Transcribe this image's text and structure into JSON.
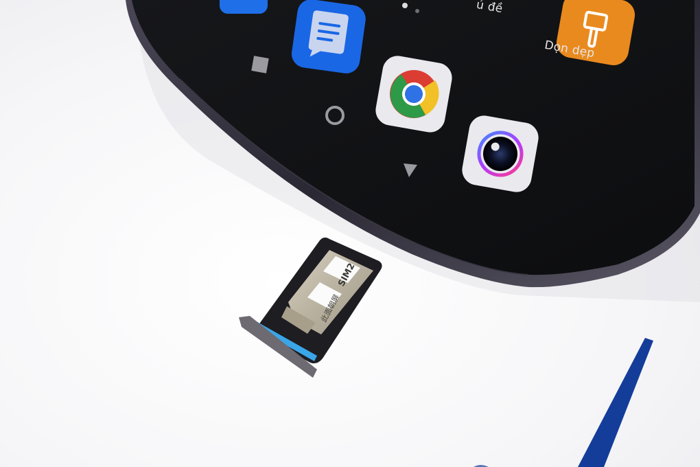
{
  "scene": {
    "description_label": "Phone home screen corner with ejected SIM tray",
    "colors": {
      "background": "#f7f7f9",
      "phone_frame": "#2a2833",
      "phone_screen": "#0f1012",
      "tray_metal": "#bfb8a6",
      "tray_accent": "#3aa6e8",
      "brand_stripe": "#143d9a"
    }
  },
  "home_screen": {
    "apps": [
      {
        "name": "messages-app-icon",
        "label": ""
      },
      {
        "name": "chrome-app-icon",
        "label": ""
      },
      {
        "name": "camera-app-icon",
        "label": ""
      },
      {
        "name": "cleaner-app-icon",
        "label": "Dọn dẹp"
      },
      {
        "name": "themes-app-icon",
        "label": "ủ đề"
      }
    ],
    "page_indicator": {
      "pages": 3,
      "active": 0
    }
  },
  "navigation_bar": {
    "buttons": [
      "recents-button",
      "home-button",
      "back-button"
    ]
  },
  "sim_tray": {
    "slot_label": "SIM2",
    "chinese_marking": "此面朝屏"
  }
}
